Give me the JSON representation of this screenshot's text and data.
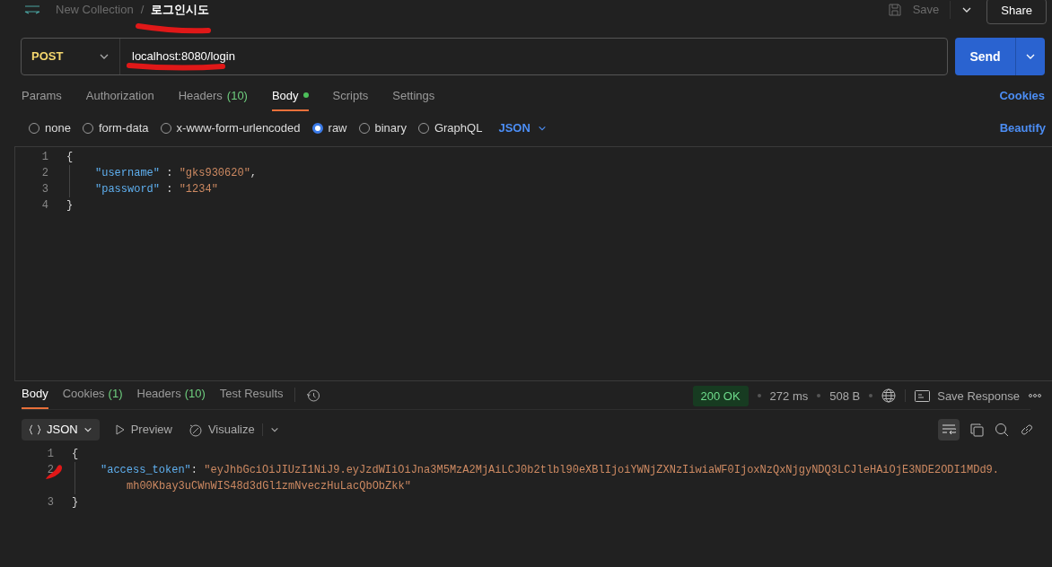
{
  "breadcrumb": {
    "collection": "New Collection",
    "separator": "/",
    "request": "로그인시도"
  },
  "toolbar": {
    "save": "Save",
    "share": "Share"
  },
  "request": {
    "method": "POST",
    "url": "localhost:8080/login",
    "send": "Send"
  },
  "request_tabs": [
    {
      "label": "Params",
      "selected": false
    },
    {
      "label": "Authorization",
      "selected": false
    },
    {
      "label": "Headers",
      "count": "(10)",
      "selected": false
    },
    {
      "label": "Body",
      "selected": true,
      "dot": true
    },
    {
      "label": "Scripts",
      "selected": false
    },
    {
      "label": "Settings",
      "selected": false
    }
  ],
  "cookies_link": "Cookies",
  "body_types": [
    {
      "label": "none",
      "selected": false
    },
    {
      "label": "form-data",
      "selected": false
    },
    {
      "label": "x-www-form-urlencoded",
      "selected": false
    },
    {
      "label": "raw",
      "selected": true
    },
    {
      "label": "binary",
      "selected": false
    },
    {
      "label": "GraphQL",
      "selected": false
    }
  ],
  "raw_format": "JSON",
  "beautify": "Beautify",
  "request_body": [
    {
      "number": "1",
      "tokens": [
        {
          "kind": "punct",
          "text": "{"
        }
      ]
    },
    {
      "number": "2",
      "indent": true,
      "tokens": [
        {
          "kind": "key",
          "text": "\"username\""
        },
        {
          "kind": "punct",
          "text": " : "
        },
        {
          "kind": "string",
          "text": "\"gks930620\""
        },
        {
          "kind": "punct",
          "text": ","
        }
      ]
    },
    {
      "number": "3",
      "indent": true,
      "tokens": [
        {
          "kind": "key",
          "text": "\"password\""
        },
        {
          "kind": "punct",
          "text": " : "
        },
        {
          "kind": "string",
          "text": "\"1234\""
        }
      ]
    },
    {
      "number": "4",
      "tokens": [
        {
          "kind": "punct",
          "text": "}"
        }
      ]
    }
  ],
  "response_tabs": [
    {
      "label": "Body",
      "selected": true
    },
    {
      "label": "Cookies",
      "count": "(1)",
      "selected": false
    },
    {
      "label": "Headers",
      "count": "(10)",
      "selected": false
    },
    {
      "label": "Test Results",
      "selected": false
    }
  ],
  "status": {
    "code": "200 OK",
    "time": "272 ms",
    "size": "508 B",
    "save_response": "Save Response"
  },
  "response_view": {
    "format": "JSON",
    "preview": "Preview",
    "visualize": "Visualize"
  },
  "response_body": [
    {
      "number": "1",
      "tokens": [
        {
          "kind": "punct",
          "text": "{"
        }
      ]
    },
    {
      "number": "2",
      "indent": true,
      "tokens": [
        {
          "kind": "key",
          "text": "\"access_token\""
        },
        {
          "kind": "punct",
          "text": ": "
        },
        {
          "kind": "string",
          "text": "\"eyJhbGciOiJIUzI1NiJ9.eyJzdWIiOiJna3M5MzA2MjAiLCJ0b2tlbl90eXBlIjoiYWNjZXNzIiwiaWF0IjoxNzQxNjgyNDQ3LCJleHAiOjE3NDE2ODI1MDd9."
        },
        {
          "kind": "wrap",
          "text": "mh00Kbay3uCWnWIS48d3dGl1zmNveczHuLacQbObZkk\""
        }
      ]
    },
    {
      "number": "3",
      "tokens": [
        {
          "kind": "punct",
          "text": "}"
        }
      ]
    }
  ]
}
